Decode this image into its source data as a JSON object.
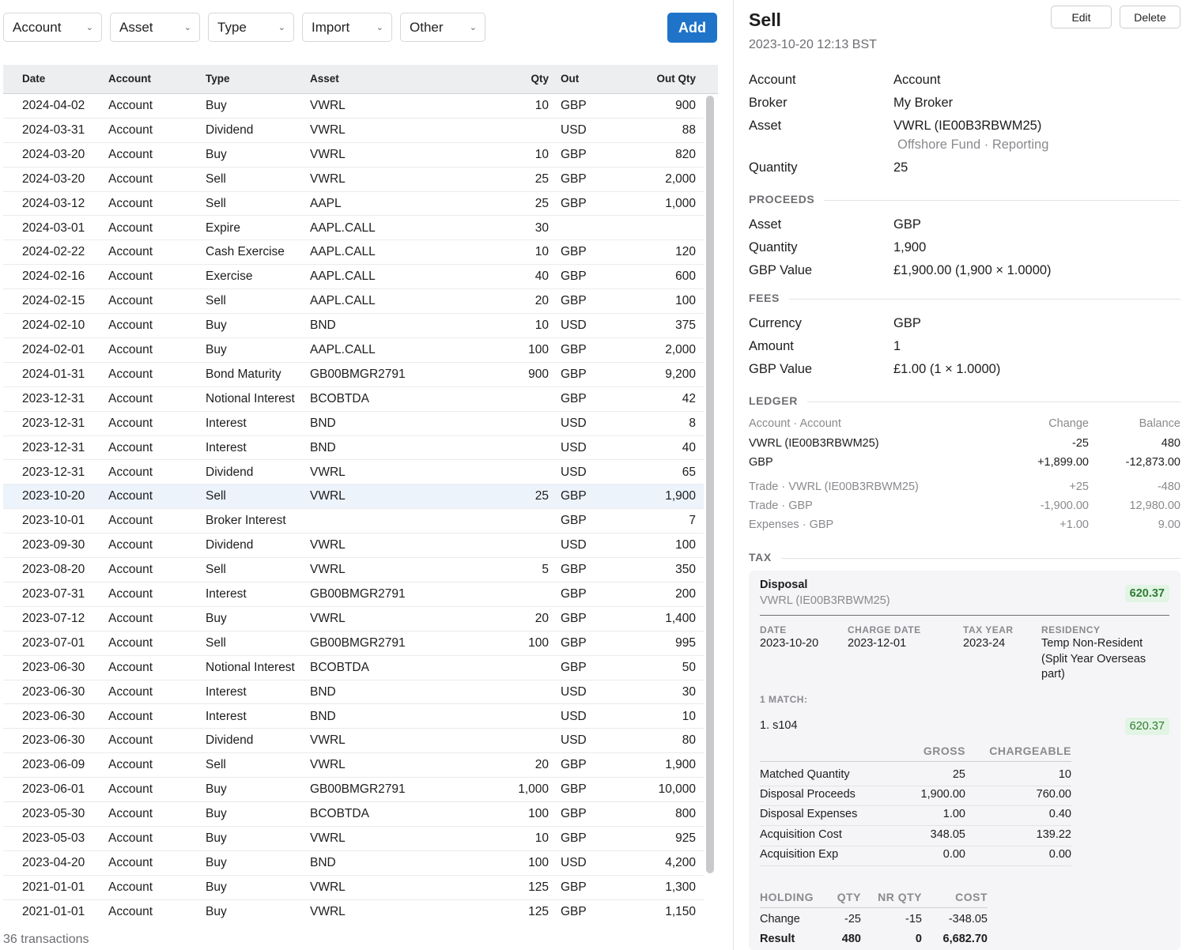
{
  "filters": [
    "Account",
    "Asset",
    "Type",
    "Import",
    "Other"
  ],
  "add_label": "Add",
  "columns": {
    "date": "Date",
    "account": "Account",
    "type": "Type",
    "asset": "Asset",
    "qty": "Qty",
    "out": "Out",
    "out_qty": "Out Qty"
  },
  "rows": [
    [
      "2024-04-02",
      "Account",
      "Buy",
      "VWRL",
      "10",
      "GBP",
      "900"
    ],
    [
      "2024-03-31",
      "Account",
      "Dividend",
      "VWRL",
      "",
      "USD",
      "88"
    ],
    [
      "2024-03-20",
      "Account",
      "Buy",
      "VWRL",
      "10",
      "GBP",
      "820"
    ],
    [
      "2024-03-20",
      "Account",
      "Sell",
      "VWRL",
      "25",
      "GBP",
      "2,000"
    ],
    [
      "2024-03-12",
      "Account",
      "Sell",
      "AAPL",
      "25",
      "GBP",
      "1,000"
    ],
    [
      "2024-03-01",
      "Account",
      "Expire",
      "AAPL.CALL",
      "30",
      "",
      ""
    ],
    [
      "2024-02-22",
      "Account",
      "Cash Exercise",
      "AAPL.CALL",
      "10",
      "GBP",
      "120"
    ],
    [
      "2024-02-16",
      "Account",
      "Exercise",
      "AAPL.CALL",
      "40",
      "GBP",
      "600"
    ],
    [
      "2024-02-15",
      "Account",
      "Sell",
      "AAPL.CALL",
      "20",
      "GBP",
      "100"
    ],
    [
      "2024-02-10",
      "Account",
      "Buy",
      "BND",
      "10",
      "USD",
      "375"
    ],
    [
      "2024-02-01",
      "Account",
      "Buy",
      "AAPL.CALL",
      "100",
      "GBP",
      "2,000"
    ],
    [
      "2024-01-31",
      "Account",
      "Bond Maturity",
      "GB00BMGR2791",
      "900",
      "GBP",
      "9,200"
    ],
    [
      "2023-12-31",
      "Account",
      "Notional Interest",
      "BCOBTDA",
      "",
      "GBP",
      "42"
    ],
    [
      "2023-12-31",
      "Account",
      "Interest",
      "BND",
      "",
      "USD",
      "8"
    ],
    [
      "2023-12-31",
      "Account",
      "Interest",
      "BND",
      "",
      "USD",
      "40"
    ],
    [
      "2023-12-31",
      "Account",
      "Dividend",
      "VWRL",
      "",
      "USD",
      "65"
    ],
    [
      "2023-10-20",
      "Account",
      "Sell",
      "VWRL",
      "25",
      "GBP",
      "1,900"
    ],
    [
      "2023-10-01",
      "Account",
      "Broker Interest",
      "",
      "",
      "GBP",
      "7"
    ],
    [
      "2023-09-30",
      "Account",
      "Dividend",
      "VWRL",
      "",
      "USD",
      "100"
    ],
    [
      "2023-08-20",
      "Account",
      "Sell",
      "VWRL",
      "5",
      "GBP",
      "350"
    ],
    [
      "2023-07-31",
      "Account",
      "Interest",
      "GB00BMGR2791",
      "",
      "GBP",
      "200"
    ],
    [
      "2023-07-12",
      "Account",
      "Buy",
      "VWRL",
      "20",
      "GBP",
      "1,400"
    ],
    [
      "2023-07-01",
      "Account",
      "Sell",
      "GB00BMGR2791",
      "100",
      "GBP",
      "995"
    ],
    [
      "2023-06-30",
      "Account",
      "Notional Interest",
      "BCOBTDA",
      "",
      "GBP",
      "50"
    ],
    [
      "2023-06-30",
      "Account",
      "Interest",
      "BND",
      "",
      "USD",
      "30"
    ],
    [
      "2023-06-30",
      "Account",
      "Interest",
      "BND",
      "",
      "USD",
      "10"
    ],
    [
      "2023-06-30",
      "Account",
      "Dividend",
      "VWRL",
      "",
      "USD",
      "80"
    ],
    [
      "2023-06-09",
      "Account",
      "Sell",
      "VWRL",
      "20",
      "GBP",
      "1,900"
    ],
    [
      "2023-06-01",
      "Account",
      "Buy",
      "GB00BMGR2791",
      "1,000",
      "GBP",
      "10,000"
    ],
    [
      "2023-05-30",
      "Account",
      "Buy",
      "BCOBTDA",
      "100",
      "GBP",
      "800"
    ],
    [
      "2023-05-03",
      "Account",
      "Buy",
      "VWRL",
      "10",
      "GBP",
      "925"
    ],
    [
      "2023-04-20",
      "Account",
      "Buy",
      "BND",
      "100",
      "USD",
      "4,200"
    ],
    [
      "2021-01-01",
      "Account",
      "Buy",
      "VWRL",
      "125",
      "GBP",
      "1,300"
    ],
    [
      "2021-01-01",
      "Account",
      "Buy",
      "VWRL",
      "125",
      "GBP",
      "1,150"
    ]
  ],
  "selected_row": 16,
  "count_label": "36 transactions",
  "detail": {
    "title": "Sell",
    "timestamp": "2023-10-20 12:13 BST",
    "edit_label": "Edit",
    "delete_label": "Delete",
    "account_k": "Account",
    "account_v": "Account",
    "broker_k": "Broker",
    "broker_v": "My Broker",
    "asset_k": "Asset",
    "asset_v": "VWRL (IE00B3RBWM25)",
    "asset_sub": "Offshore Fund · Reporting",
    "quantity_k": "Quantity",
    "quantity_v": "25",
    "proceeds_h": "PROCEEDS",
    "p_asset_k": "Asset",
    "p_asset_v": "GBP",
    "p_qty_k": "Quantity",
    "p_qty_v": "1,900",
    "p_val_k": "GBP Value",
    "p_val_v": "£1,900.00 (1,900 × 1.0000)",
    "fees_h": "FEES",
    "f_cur_k": "Currency",
    "f_cur_v": "GBP",
    "f_amt_k": "Amount",
    "f_amt_v": "1",
    "f_val_k": "GBP Value",
    "f_val_v": "£1.00 (1 × 1.0000)",
    "ledger_h": "LEDGER",
    "ledger_head": [
      "Account · Account",
      "Change",
      "Balance"
    ],
    "ledger_rows": [
      [
        "VWRL (IE00B3RBWM25)",
        "-25",
        "480"
      ],
      [
        "GBP",
        "+1,899.00",
        "-12,873.00"
      ]
    ],
    "ledger_rows2": [
      [
        "Trade · VWRL (IE00B3RBWM25)",
        "+25",
        "-480"
      ],
      [
        "Trade · GBP",
        "-1,900.00",
        "12,980.00"
      ],
      [
        "Expenses · GBP",
        "+1.00",
        "9.00"
      ]
    ],
    "tax_h": "TAX",
    "disposal_label": "Disposal",
    "disposal_asset": "VWRL (IE00B3RBWM25)",
    "disposal_gain": "620.37",
    "meta": [
      {
        "h": "DATE",
        "v": "2023-10-20"
      },
      {
        "h": "CHARGE DATE",
        "v": "2023-12-01"
      },
      {
        "h": "TAX YEAR",
        "v": "2023-24"
      },
      {
        "h": "RESIDENCY",
        "v": "Temp Non-Resident (Split Year Overseas part)"
      }
    ],
    "match_h": "1 MATCH:",
    "match_label": "1. s104",
    "match_gain": "620.37",
    "calc_head": [
      "GROSS",
      "CHARGEABLE"
    ],
    "calc_rows": [
      [
        "Matched Quantity",
        "25",
        "10"
      ],
      [
        "Disposal Proceeds",
        "1,900.00",
        "760.00"
      ],
      [
        "Disposal Expenses",
        "1.00",
        "0.40"
      ],
      [
        "Acquisition Cost",
        "348.05",
        "139.22"
      ],
      [
        "Acquisition Exp",
        "0.00",
        "0.00"
      ]
    ],
    "hold_head": [
      "HOLDING",
      "QTY",
      "NR QTY",
      "COST"
    ],
    "hold_rows": [
      [
        "Change",
        "-25",
        "-15",
        "-348.05"
      ],
      [
        "Result",
        "480",
        "0",
        "6,682.70"
      ]
    ]
  },
  "colors": {
    "accent": "#1f74c9",
    "gain_bg": "#e2f4e4",
    "gain_fg": "#2e7d32",
    "selected_row": "#edf3fb"
  }
}
